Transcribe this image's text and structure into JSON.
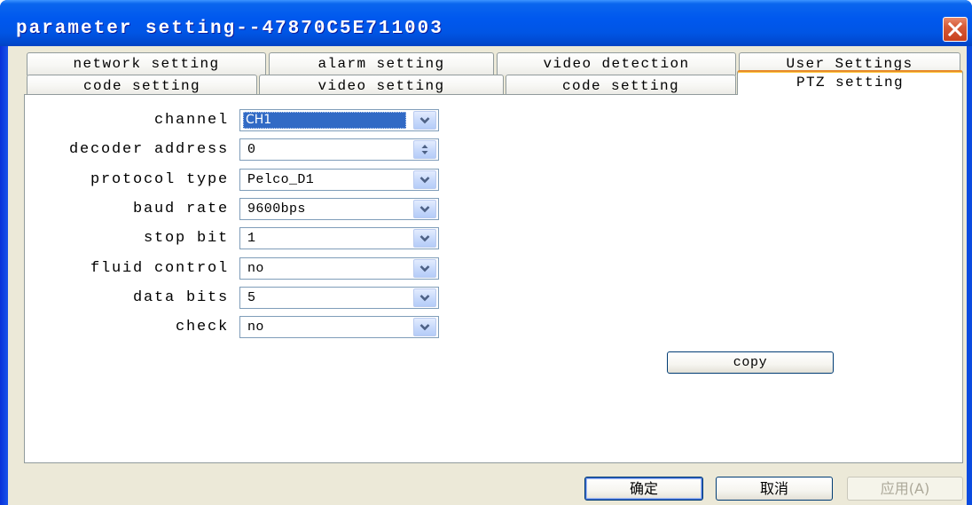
{
  "window": {
    "title": "parameter setting--47870C5E711003",
    "close_icon": "close-icon"
  },
  "tabs": {
    "row1": [
      {
        "label": "network setting"
      },
      {
        "label": "alarm setting"
      },
      {
        "label": "video detection"
      },
      {
        "label": "User Settings"
      }
    ],
    "row2": [
      {
        "label": "code setting"
      },
      {
        "label": "video setting"
      },
      {
        "label": "code setting"
      },
      {
        "label": "PTZ setting",
        "active": true
      }
    ]
  },
  "ptz_form": {
    "fields": [
      {
        "label": "channel",
        "value": "CH1",
        "button_icon": "chevron-down-icon",
        "selected": true
      },
      {
        "label": "decoder address",
        "value": "0",
        "button_icon": "spinner-icon"
      },
      {
        "label": "protocol type",
        "value": "Pelco_D1",
        "button_icon": "chevron-down-icon"
      },
      {
        "label": "baud rate",
        "value": "9600bps",
        "button_icon": "chevron-down-icon"
      },
      {
        "label": "stop bit",
        "value": "1",
        "button_icon": "chevron-down-icon"
      },
      {
        "label": "fluid control",
        "value": "no",
        "button_icon": "chevron-down-icon"
      },
      {
        "label": "data bits",
        "value": "5",
        "button_icon": "chevron-down-icon"
      },
      {
        "label": "check",
        "value": "no",
        "button_icon": "chevron-down-icon"
      }
    ],
    "copy_button": "copy"
  },
  "footer": {
    "ok_button": "确定",
    "cancel_button": "取消",
    "apply_button": {
      "label": "应用(A)",
      "enabled": false
    }
  },
  "colors": {
    "title_bar": "#0055E5",
    "active_tab_accent": "#E68B2C",
    "selection": "#316AC5",
    "client_background": "#ECE9D8"
  }
}
